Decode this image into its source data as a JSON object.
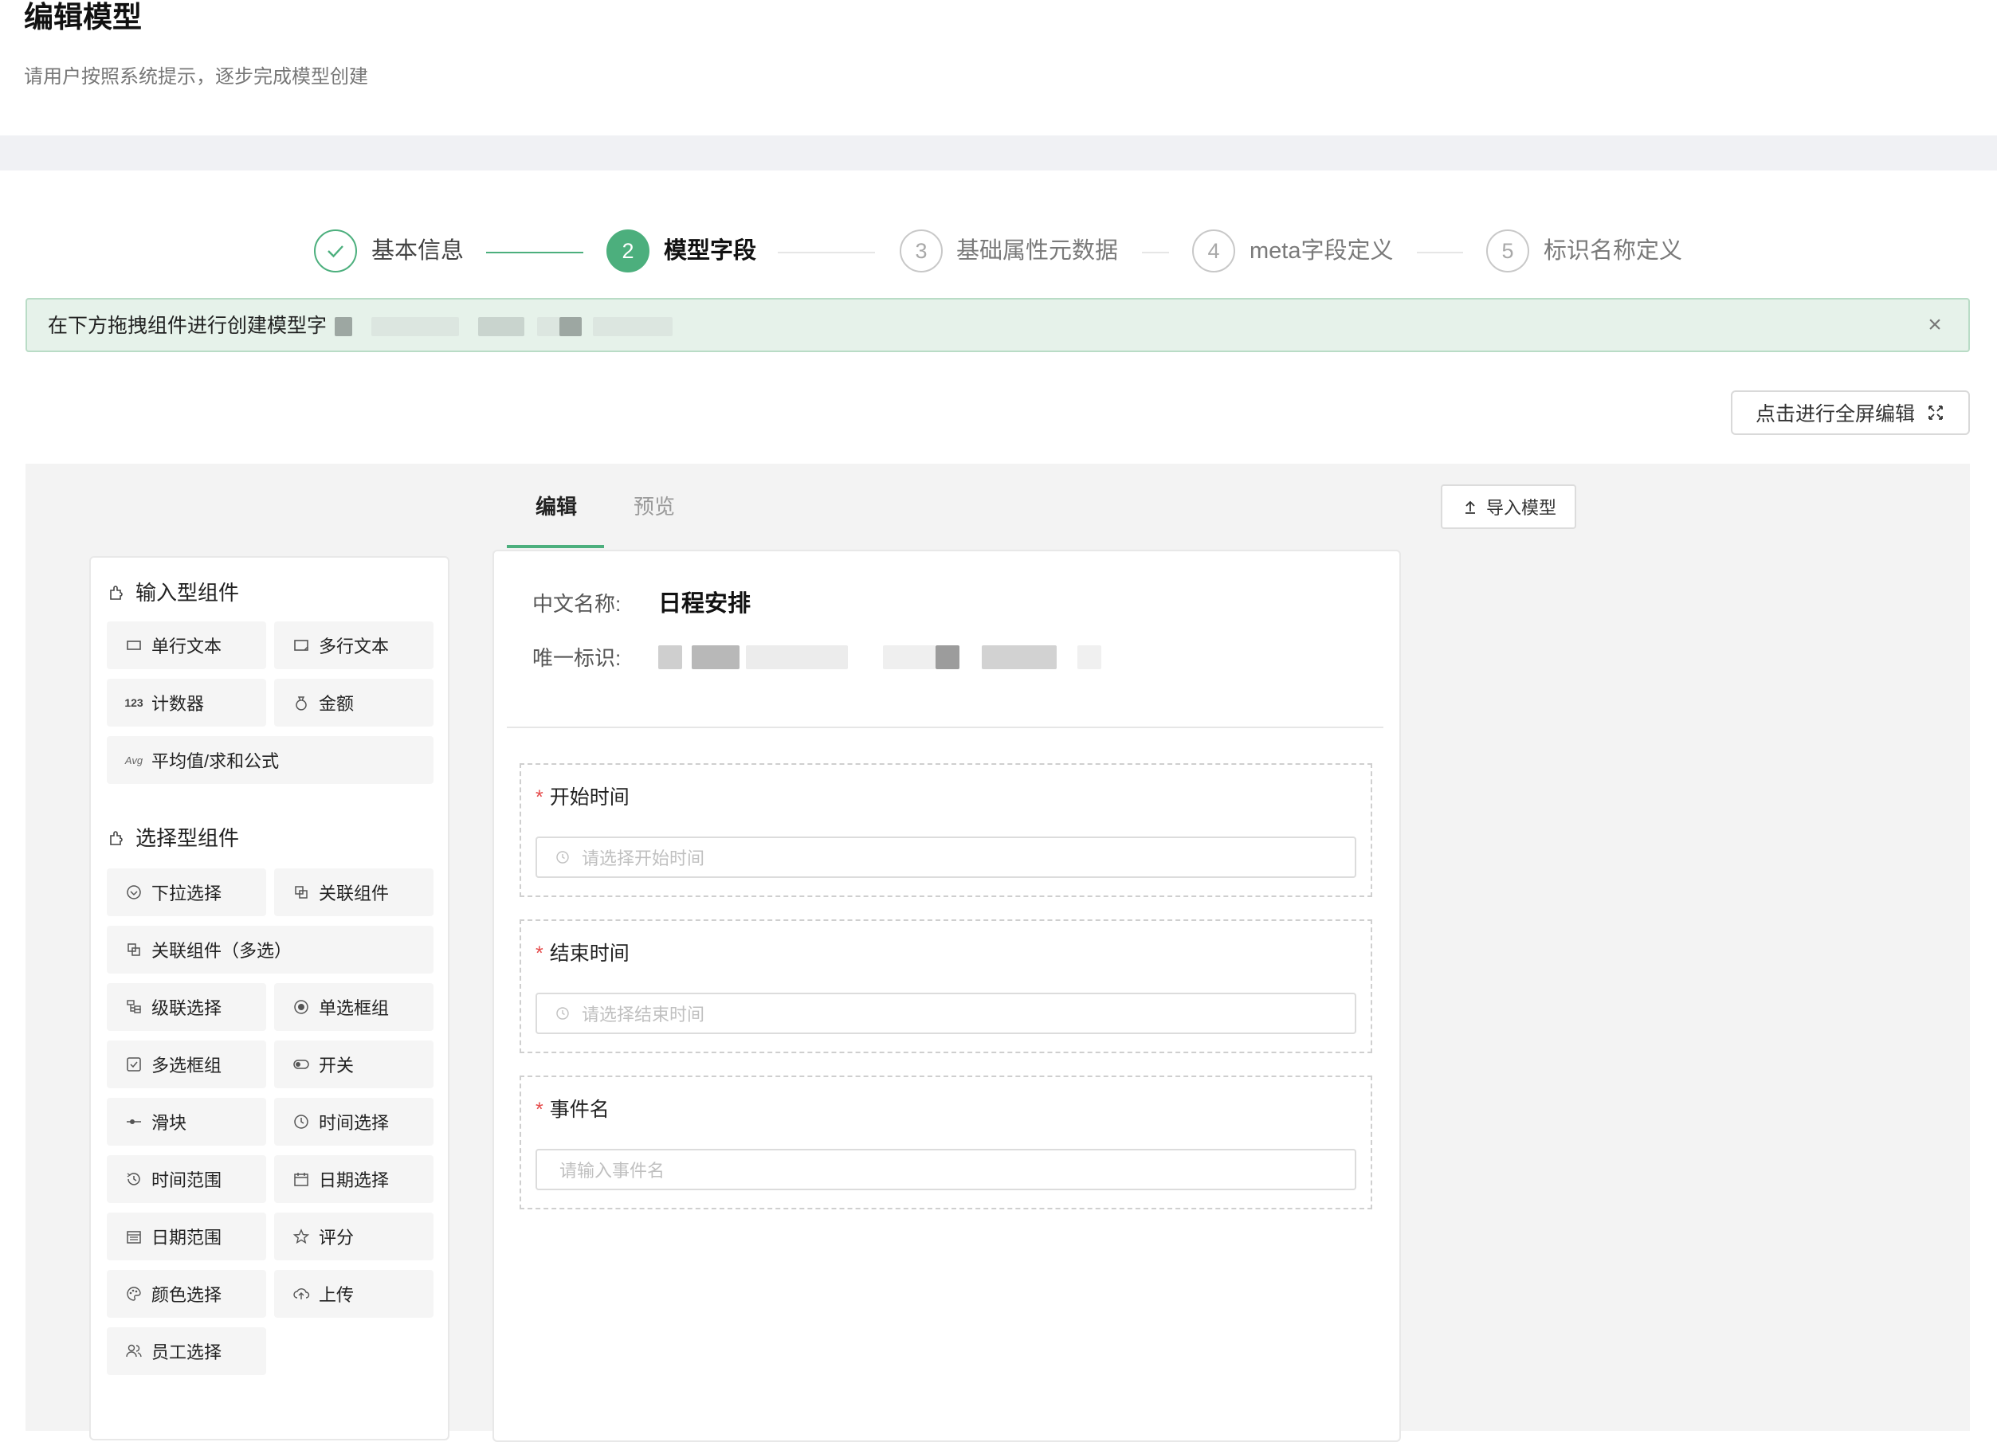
{
  "header": {
    "title": "编辑模型",
    "subtitle": "请用户按照系统提示，逐步完成模型创建"
  },
  "steps": [
    {
      "num": "✓",
      "label": "基本信息",
      "state": "done"
    },
    {
      "num": "2",
      "label": "模型字段",
      "state": "active"
    },
    {
      "num": "3",
      "label": "基础属性元数据",
      "state": "pending"
    },
    {
      "num": "4",
      "label": "meta字段定义",
      "state": "pending"
    },
    {
      "num": "5",
      "label": "标识名称定义",
      "state": "pending"
    }
  ],
  "banner": {
    "text": "在下方拖拽组件进行创建模型字",
    "close": "×"
  },
  "fullscreen": {
    "label": "点击进行全屏编辑"
  },
  "tabs": [
    {
      "label": "编辑"
    },
    {
      "label": "预览"
    }
  ],
  "import": {
    "label": "导入模型"
  },
  "palette": {
    "input_group": {
      "title": "输入型组件",
      "items": [
        "单行文本",
        "多行文本",
        "计数器",
        "金额",
        "平均值/求和公式"
      ],
      "icon_text": {
        "counter": "123",
        "avg": "Avg"
      }
    },
    "select_group": {
      "title": "选择型组件",
      "items": [
        "下拉选择",
        "关联组件",
        "关联组件（多选）",
        "级联选择",
        "单选框组",
        "多选框组",
        "开关",
        "滑块",
        "时间选择",
        "时间范围",
        "日期选择",
        "日期范围",
        "评分",
        "颜色选择",
        "上传",
        "员工选择"
      ]
    }
  },
  "form": {
    "cn_name_label": "中文名称:",
    "cn_name_value": "日程安排",
    "uid_label": "唯一标识:",
    "fields": [
      {
        "label": "开始时间",
        "placeholder": "请选择开始时间"
      },
      {
        "label": "结束时间",
        "placeholder": "请选择结束时间"
      },
      {
        "label": "事件名",
        "placeholder": "请输入事件名"
      }
    ],
    "required_mark": "*"
  },
  "colors": {
    "accent": "#4caf7d",
    "banner_bg": "#e6f2ea",
    "required": "#e54b4b"
  }
}
